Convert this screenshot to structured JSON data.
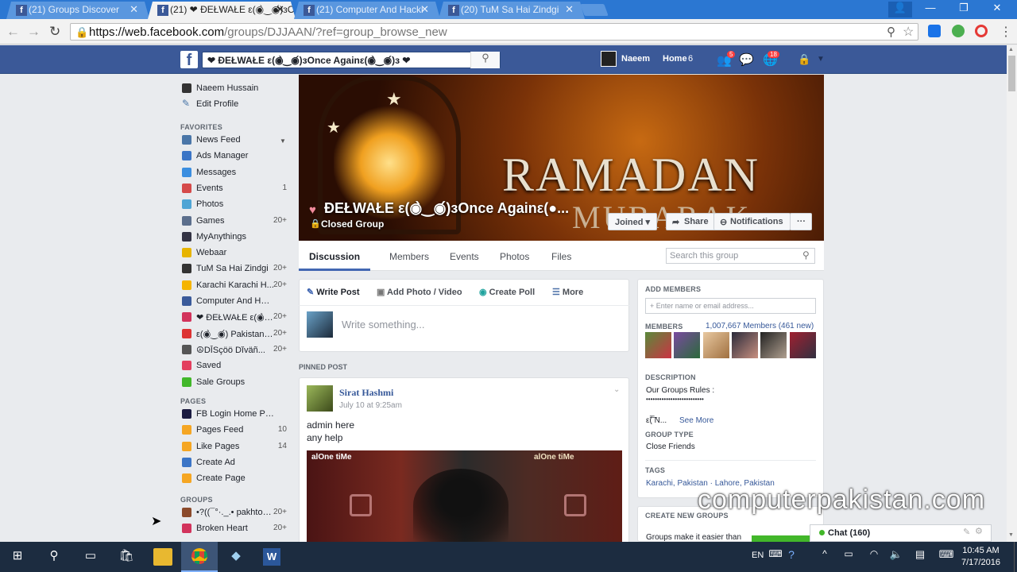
{
  "browser": {
    "tabs": [
      {
        "title": "(21) Groups Discover",
        "active": false
      },
      {
        "title": "(21) ❤ ĐEŁWAŁE ε(◉̀‿◉́)зOn",
        "active": true
      },
      {
        "title": "(21) Computer And Hacki",
        "active": false
      },
      {
        "title": "(20) TuM Sa Hai Zindgi",
        "active": false
      }
    ],
    "url_host": "https://web.facebook.com",
    "url_path": "/groups/DJJAAN/?ref=group_browse_new"
  },
  "fb": {
    "logo": "f",
    "search_value": "❤ ĐEŁWAŁE ε(◉̀‿◉́)зOnce Againε(◉̀‿◉́)з ❤",
    "user": "Naeem",
    "home": "Home",
    "home_count": "6",
    "friend_badge": "5",
    "notif_badge": "18"
  },
  "left": {
    "profile_name": "Naeem Hussain",
    "edit_profile": "Edit Profile",
    "favorites_head": "FAVORITES",
    "favorites": [
      {
        "label": "News Feed",
        "count": "",
        "icon": "news-feed-icon",
        "color": "#4a76a8"
      },
      {
        "label": "Ads Manager",
        "count": "",
        "icon": "ads-manager-icon",
        "color": "#3b75c6"
      },
      {
        "label": "Messages",
        "count": "",
        "icon": "messages-icon",
        "color": "#3b8ee0"
      },
      {
        "label": "Events",
        "count": "1",
        "icon": "calendar-icon",
        "color": "#d54a4a"
      },
      {
        "label": "Photos",
        "count": "",
        "icon": "photos-icon",
        "color": "#4fa5d5"
      },
      {
        "label": "Games",
        "count": "20+",
        "icon": "games-icon",
        "color": "#5b6e8c"
      },
      {
        "label": "MyAnythings",
        "count": "",
        "icon": "app-icon",
        "color": "#334"
      },
      {
        "label": "Webaar",
        "count": "",
        "icon": "webaar-icon",
        "color": "#e7b400"
      },
      {
        "label": "TuM Sa Hai Zindgi",
        "count": "20+",
        "icon": "group-icon",
        "color": "#333"
      },
      {
        "label": "Karachi Karachi H...",
        "count": "20+",
        "icon": "bulb-icon",
        "color": "#f5b400"
      },
      {
        "label": "Computer And Hac...",
        "count": "",
        "icon": "laptop-icon",
        "color": "#3a5a9a"
      },
      {
        "label": "❤ ĐEŁWAŁE ε(◉̀‿...",
        "count": "20+",
        "icon": "heart-icon",
        "color": "#d2335c"
      },
      {
        "label": "ε(◉̀‿◉́) Pakistan ε(◉̀‿◉́)",
        "count": "20+",
        "icon": "apple-icon",
        "color": "#d33"
      },
      {
        "label": "☮DĪSçöö Dĭväñ...",
        "count": "20+",
        "icon": "peace-icon",
        "color": "#555"
      },
      {
        "label": "Saved",
        "count": "",
        "icon": "bookmark-icon",
        "color": "#e33f5f"
      },
      {
        "label": "Sale Groups",
        "count": "",
        "icon": "tag-icon",
        "color": "#42b72a"
      }
    ],
    "pages_head": "PAGES",
    "pages": [
      {
        "label": "FB Login Home Page",
        "count": "",
        "icon": "page-icon",
        "color": "#1a1a40"
      },
      {
        "label": "Pages Feed",
        "count": "10",
        "icon": "pages-feed-icon",
        "color": "#f5a623"
      },
      {
        "label": "Like Pages",
        "count": "14",
        "icon": "like-pages-icon",
        "color": "#f5a623"
      },
      {
        "label": "Create Ad",
        "count": "",
        "icon": "create-ad-icon",
        "color": "#3b75c6"
      },
      {
        "label": "Create Page",
        "count": "",
        "icon": "create-page-icon",
        "color": "#f5a623"
      }
    ],
    "groups_head": "GROUPS",
    "groups": [
      {
        "label": "•?((¯°·._.• pakhtoo...",
        "count": "20+",
        "icon": "cup-icon",
        "color": "#8b4a2b"
      },
      {
        "label": "Broken Heart",
        "count": "20+",
        "icon": "broken-heart-icon",
        "color": "#d2335c"
      }
    ]
  },
  "cover": {
    "image_text_1": "RAMADAN",
    "image_text_2": "MUBARAK",
    "group_name": "ĐEŁWAŁE ε(◉̀‿◉́)зOnce Againε(●...",
    "privacy": "Closed Group",
    "joined": "Joined ▾",
    "share": "Share",
    "notifications": "Notifications",
    "more": "···"
  },
  "group_tabs": {
    "items": [
      "Discussion",
      "Members",
      "Events",
      "Photos",
      "Files"
    ],
    "active": "Discussion",
    "search_placeholder": "Search this group"
  },
  "composer": {
    "write_post": "Write Post",
    "add_photo": "Add Photo / Video",
    "create_poll": "Create Poll",
    "more": "More",
    "placeholder": "Write something..."
  },
  "pinned": {
    "label": "PINNED POST",
    "author": "Sirat Hashmi",
    "time": "July 10 at 9:25am",
    "line1": "admin here",
    "line2": "any help",
    "image_text_left": "alOne tiMe",
    "image_text_right": "alOne tiMe"
  },
  "right": {
    "add_members_head": "ADD MEMBERS",
    "add_members_placeholder": "+ Enter name or email address...",
    "members_head": "MEMBERS",
    "members_count": "1,007,667 Members (461 new)",
    "description_head": "DESCRIPTION",
    "description_line1": "Our Groups Rules :",
    "description_line2": "••••••••••••••••••••••••••",
    "description_line3": "ε(̅͞ N...",
    "see_more": "See More",
    "group_type_head": "GROUP TYPE",
    "group_type": "Close Friends",
    "tags_head": "TAGS",
    "tags": "Karachi, Pakistan · Lahore, Pakistan",
    "create_groups_head": "CREATE NEW GROUPS",
    "create_groups_text": "Groups make it easier than"
  },
  "watermark": "computerpakistan.com",
  "chat": {
    "label": "Chat (160)"
  },
  "taskbar": {
    "lang": "EN",
    "time": "10:45 AM",
    "date": "7/17/2016"
  }
}
